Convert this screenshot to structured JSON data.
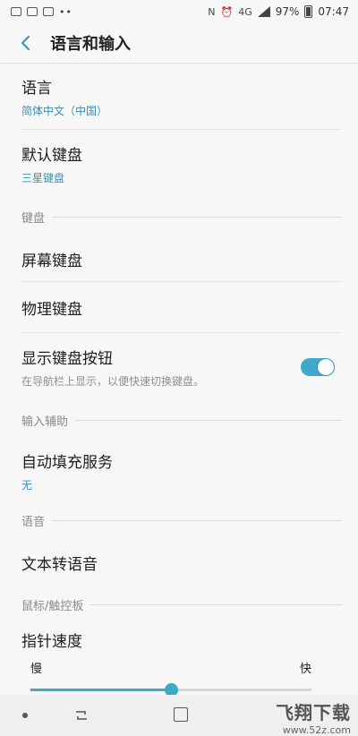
{
  "status_bar": {
    "battery": "97%",
    "time": "07:47",
    "network": "4G"
  },
  "app_bar": {
    "title": "语言和输入"
  },
  "items": {
    "language": {
      "title": "语言",
      "value": "简体中文（中国）"
    },
    "default_keyboard": {
      "title": "默认键盘",
      "value": "三星键盘"
    },
    "section_keyboard": "键盘",
    "screen_keyboard": {
      "title": "屏幕键盘"
    },
    "physical_keyboard": {
      "title": "物理键盘"
    },
    "show_keyboard_button": {
      "title": "显示键盘按钮",
      "desc": "在导航栏上显示，以便快速切换键盘。",
      "enabled": true
    },
    "section_input_assist": "输入辅助",
    "autofill": {
      "title": "自动填充服务",
      "value": "无"
    },
    "section_voice": "语音",
    "tts": {
      "title": "文本转语音"
    },
    "section_mouse": "鼠标/触控板",
    "pointer_speed": {
      "title": "指针速度",
      "slow": "慢",
      "fast": "快",
      "value_percent": 50
    }
  },
  "watermark": {
    "text": "飞翔下载",
    "url": "www.52z.com"
  },
  "colors": {
    "accent": "#3fa8cb",
    "subtext_blue": "#3b8fb0"
  }
}
